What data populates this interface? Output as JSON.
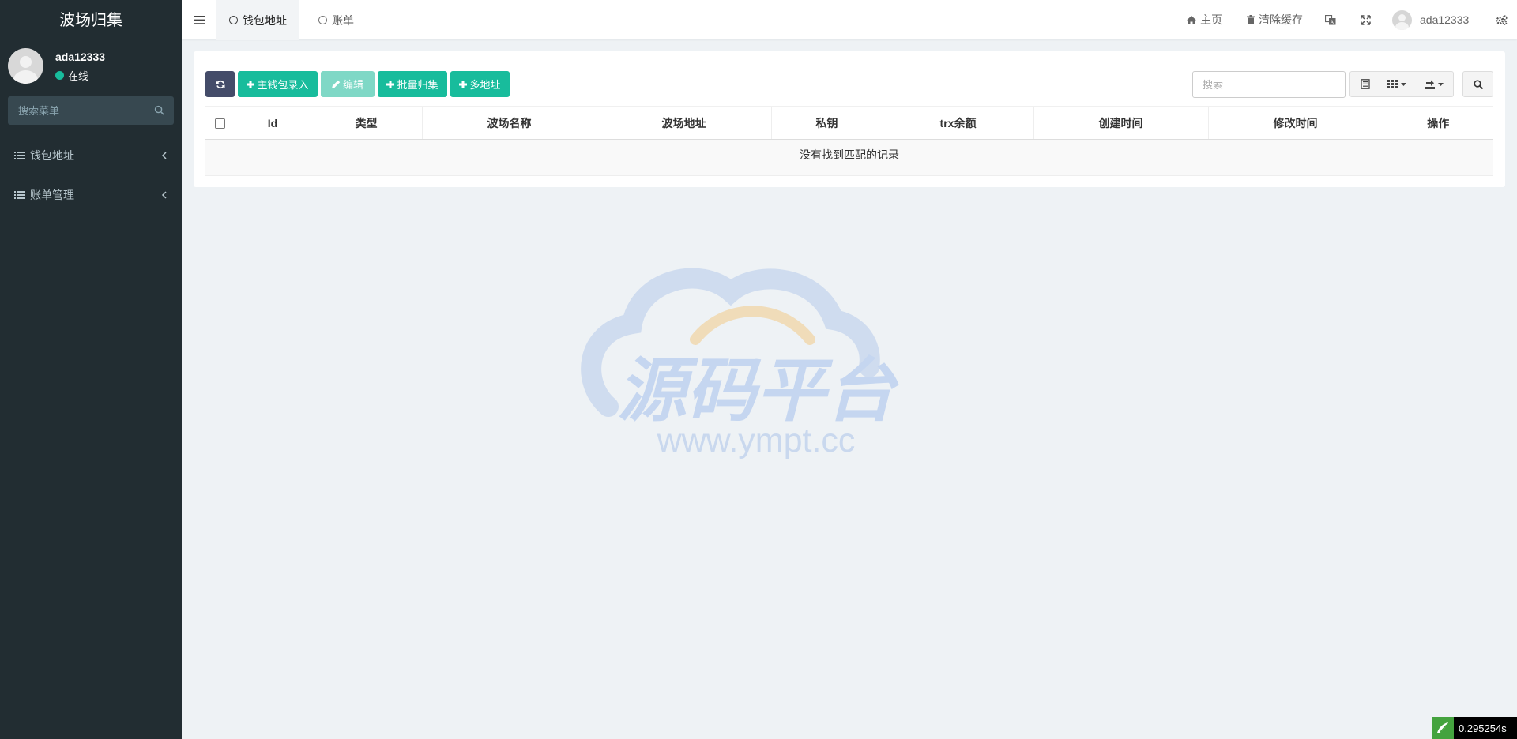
{
  "sidebar": {
    "brand": "波场归集",
    "user": {
      "name": "ada12333",
      "status": "在线"
    },
    "search_placeholder": "搜索菜单",
    "menu": [
      {
        "label": "钱包地址",
        "icon": "list-icon"
      },
      {
        "label": "账单管理",
        "icon": "list-icon"
      }
    ]
  },
  "topbar": {
    "tabs": [
      {
        "label": "钱包地址",
        "active": true
      },
      {
        "label": "账单",
        "active": false
      }
    ],
    "home": "主页",
    "clear_cache": "清除缓存",
    "username": "ada12333"
  },
  "toolbar": {
    "add_main_wallet": "主钱包录入",
    "edit": "编辑",
    "batch_collect": "批量归集",
    "multi_address": "多地址",
    "search_placeholder": "搜索"
  },
  "table": {
    "columns": [
      "Id",
      "类型",
      "波场名称",
      "波场地址",
      "私钥",
      "trx余额",
      "创建时间",
      "修改时间",
      "操作"
    ],
    "empty_message": "没有找到匹配的记录"
  },
  "watermark": {
    "brand": "源码平台",
    "url": "www.ympt.cc"
  },
  "timer": "0.295254s",
  "colors": {
    "sidebar_bg": "#222d32",
    "accent_green": "#18bc9c",
    "refresh_btn": "#444c69"
  }
}
